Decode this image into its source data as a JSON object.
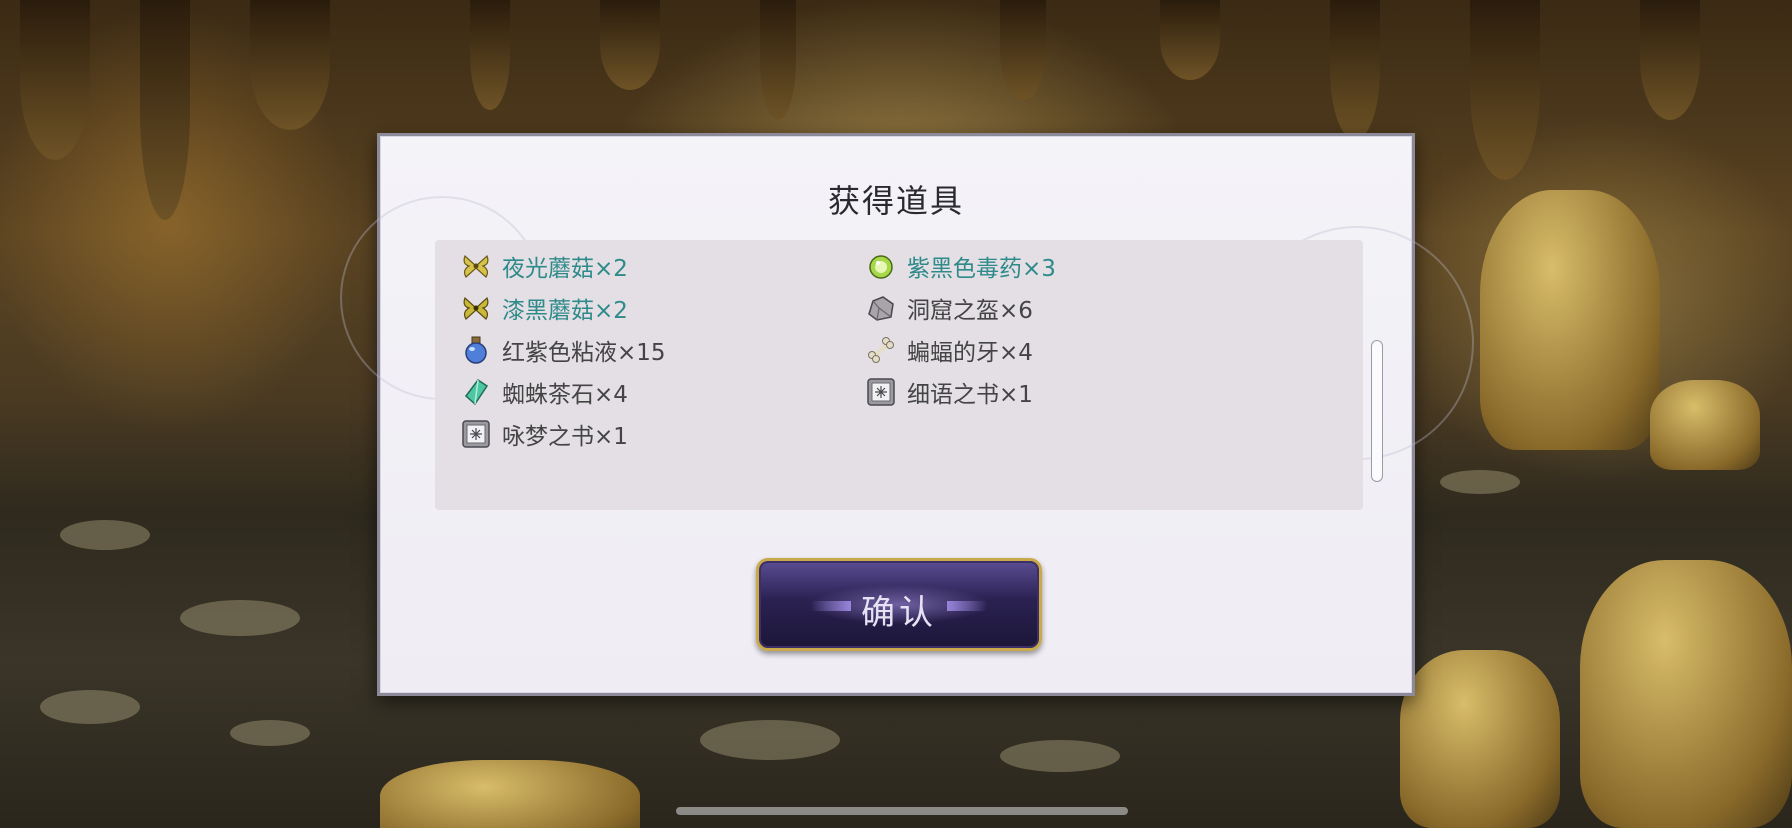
{
  "dialog": {
    "title": "获得道具",
    "confirm_label": "确认"
  },
  "items_left": [
    {
      "name": "夜光蘑菇×2",
      "icon": "butterfly-mushroom-icon",
      "color": "#2f8a8a"
    },
    {
      "name": "漆黑蘑菇×2",
      "icon": "butterfly-mushroom-icon",
      "color": "#2f8a8a"
    },
    {
      "name": "红紫色粘液×15",
      "icon": "potion-bottle-icon",
      "color": "#444444"
    },
    {
      "name": "蜘蛛茶石×4",
      "icon": "green-crystal-icon",
      "color": "#444444"
    },
    {
      "name": "咏梦之书×1",
      "icon": "spell-book-icon",
      "color": "#444444"
    }
  ],
  "items_right": [
    {
      "name": "紫黑色毒药×3",
      "icon": "green-orb-icon",
      "color": "#2f8a8a"
    },
    {
      "name": "洞窟之盔×6",
      "icon": "stone-icon",
      "color": "#444444"
    },
    {
      "name": "蝙蝠的牙×4",
      "icon": "bone-icon",
      "color": "#444444"
    },
    {
      "name": "细语之书×1",
      "icon": "spell-book-icon",
      "color": "#444444"
    }
  ],
  "scroll": {
    "position": 0.42
  }
}
